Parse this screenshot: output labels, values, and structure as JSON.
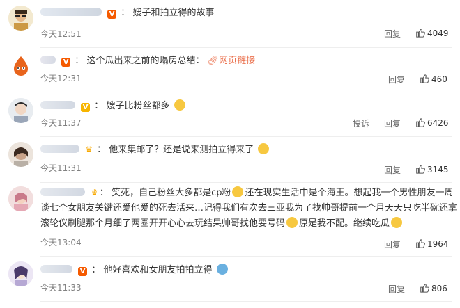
{
  "comments": [
    {
      "text": "嫂子和拍立得的故事",
      "time": "今天12:51",
      "reply": "回复",
      "likes": "4049"
    },
    {
      "text": "这个瓜出来之前的塌房总结：",
      "link": "网页链接",
      "time": "今天12:31",
      "reply": "回复",
      "likes": "460"
    },
    {
      "text": "嫂子比粉丝都多",
      "time": "今天11:37",
      "report": "投诉",
      "reply": "回复",
      "likes": "6426"
    },
    {
      "text": "他来集邮了？还是说来测拍立得来了",
      "time": "今天11:31",
      "reply": "回复",
      "likes": "3145"
    },
    {
      "line1a": "笑死，自己粉丝大多都是cp粉",
      "line1b": "还在现实生活中是个海王。想起我一个男性朋友一周",
      "line2": "谈七个女朋友关键还爱他爱的死去活来…记得我们有次去三亚我为了找帅哥提前一个月天天只吃半碗还拿了个",
      "line3a": "滚轮仪刷腿那个月细了两圈开开心心去玩结果帅哥找他要号码",
      "line3b": "原是我不配。继续吃瓜",
      "time": "今天13:04",
      "reply": "回复",
      "likes": "1964"
    },
    {
      "text": "他好喜欢和女朋友拍拍立得",
      "time": "今天11:33",
      "reply": "回复",
      "likes": "806"
    }
  ],
  "icons": {
    "verified": "V",
    "crown": "crown-icon",
    "like": "thumbs-up-icon",
    "link": "link-icon"
  }
}
